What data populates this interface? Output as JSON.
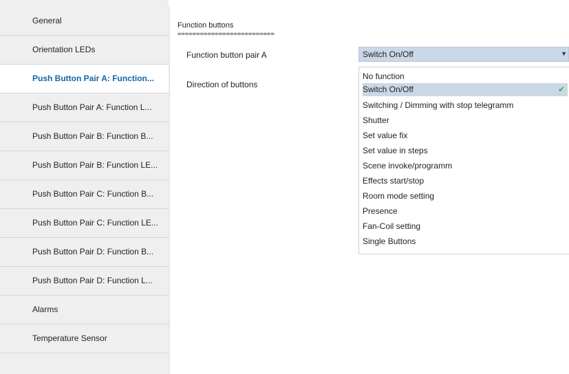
{
  "sidebar": {
    "items": [
      {
        "label": "General",
        "active": false
      },
      {
        "label": "Orientation LEDs",
        "active": false
      },
      {
        "label": "Push Button Pair A: Function...",
        "active": true
      },
      {
        "label": "Push Button Pair A: Function L...",
        "active": false
      },
      {
        "label": "Push Button Pair B: Function B...",
        "active": false
      },
      {
        "label": "Push Button Pair B: Function LE...",
        "active": false
      },
      {
        "label": "Push Button Pair C: Function B...",
        "active": false
      },
      {
        "label": "Push Button Pair C: Function LE...",
        "active": false
      },
      {
        "label": "Push Button Pair D: Function B...",
        "active": false
      },
      {
        "label": "Push Button Pair D: Function L...",
        "active": false
      },
      {
        "label": "Alarms",
        "active": false
      },
      {
        "label": "Temperature Sensor",
        "active": false
      }
    ]
  },
  "main": {
    "section_title": "Function buttons",
    "section_underline": "==========================",
    "params": [
      {
        "label": "Function button pair A"
      },
      {
        "label": "Direction of buttons"
      }
    ],
    "dropdown": {
      "value": "Switch On/Off",
      "arrow_icon": "chevron-down-icon",
      "options": [
        "No function",
        "Switch On/Off",
        "Switching / Dimming with stop telegramm",
        "Shutter",
        "Set value fix",
        "Set value in steps",
        "Scene invoke/programm",
        "Effects start/stop",
        "Room mode setting",
        "Presence",
        "Fan-Coil setting",
        "Single Buttons"
      ],
      "selected_index": 1
    }
  },
  "colors": {
    "active_text": "#1464a5",
    "selection_bg": "#c9d7e6",
    "check": "#5aa642",
    "sidebar_bg": "#efefef"
  }
}
